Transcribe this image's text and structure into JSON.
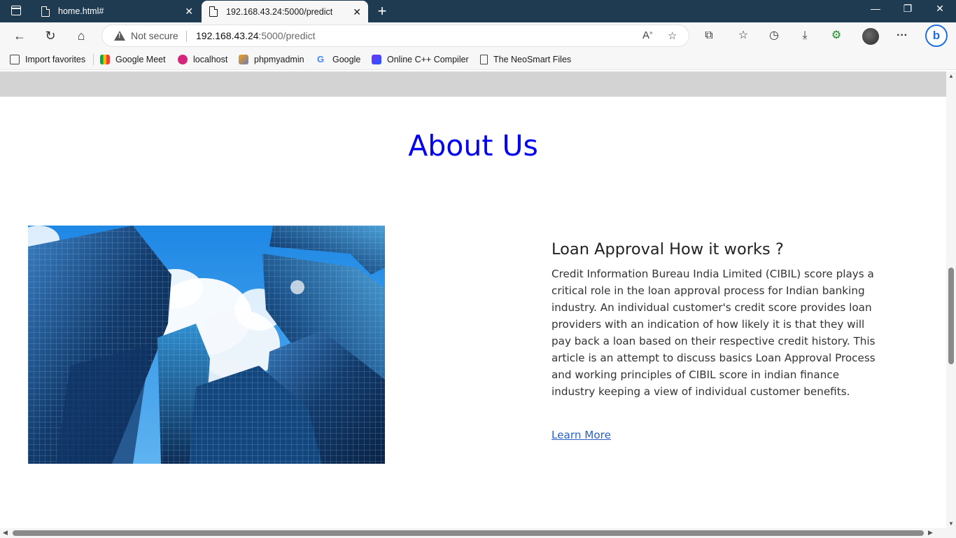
{
  "browser": {
    "tabs": [
      {
        "label": "home.html#"
      },
      {
        "label": "192.168.43.24:5000/predict"
      }
    ],
    "window_controls": {
      "minimize": "—",
      "restore": "❐",
      "close": "✕"
    },
    "security_label": "Not secure",
    "url_host": "192.168.43.24",
    "url_path": ":5000/predict",
    "bookmarks": [
      {
        "label": "Import favorites"
      },
      {
        "label": "Google Meet"
      },
      {
        "label": "localhost"
      },
      {
        "label": "phpmyadmin"
      },
      {
        "label": "Google"
      },
      {
        "label": "Online C++ Compiler"
      },
      {
        "label": "The NeoSmart Files"
      }
    ]
  },
  "page": {
    "title": "About Us",
    "heading": "Loan Approval How it works ?",
    "body": "Credit Information Bureau India Limited (CIBIL) score plays a critical role in the loan approval process for Indian banking industry. An individual customer's credit score provides loan providers with an indication of how likely it is that they will pay back a loan based on their respective credit history. This article is an attempt to discuss basics Loan Approval Process and working principles of CIBIL score in indian finance industry keeping a view of individual customer benefits.",
    "link_label": "Learn More"
  },
  "colors": {
    "titlebar": "#1f3b52",
    "page_title": "#0000ee",
    "link": "#2a62c9"
  }
}
